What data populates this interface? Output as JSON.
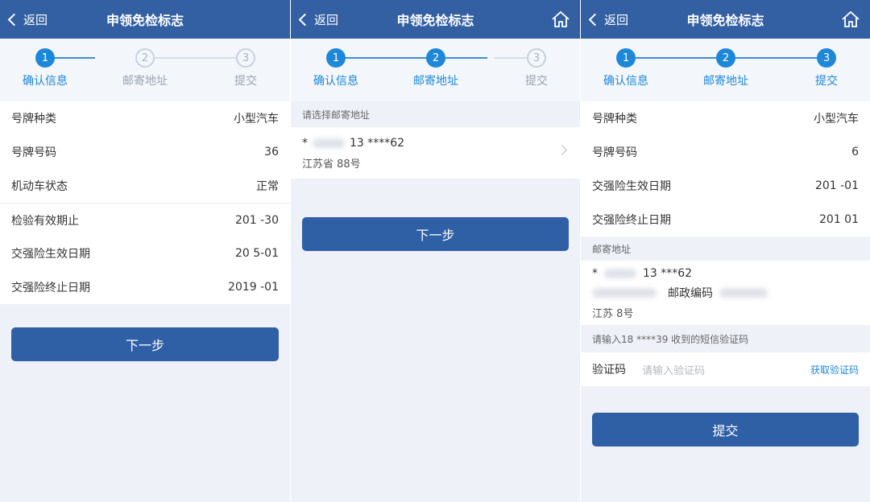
{
  "screens": [
    {
      "nav": {
        "back": "返回",
        "title": "申领免检标志"
      },
      "steps": [
        {
          "num": "1",
          "label": "确认信息",
          "state": "on"
        },
        {
          "num": "2",
          "label": "邮寄地址",
          "state": "off"
        },
        {
          "num": "3",
          "label": "提交",
          "state": "off"
        }
      ],
      "rows": [
        {
          "label": "号牌种类",
          "value": "小型汽车"
        },
        {
          "label": "号牌号码",
          "value": "36"
        },
        {
          "label": "机动车状态",
          "value": "正常"
        },
        {
          "label": "检验有效期止",
          "value": "201 -30"
        },
        {
          "label": "交强险生效日期",
          "value": "20 5-01"
        },
        {
          "label": "交强险终止日期",
          "value": "2019 -01"
        }
      ],
      "button": "下一步"
    },
    {
      "nav": {
        "back": "返回",
        "title": "申领免检标志"
      },
      "steps": [
        {
          "num": "1",
          "label": "确认信息",
          "state": "on"
        },
        {
          "num": "2",
          "label": "邮寄地址",
          "state": "on"
        },
        {
          "num": "3",
          "label": "提交",
          "state": "off"
        }
      ],
      "section_header": "请选择邮寄地址",
      "address": {
        "line1_prefix": "*",
        "phone": "13 ****62",
        "line2": "江苏省 88号"
      },
      "button": "下一步"
    },
    {
      "nav": {
        "back": "返回",
        "title": "申领免检标志"
      },
      "steps": [
        {
          "num": "1",
          "label": "确认信息",
          "state": "on"
        },
        {
          "num": "2",
          "label": "邮寄地址",
          "state": "on"
        },
        {
          "num": "3",
          "label": "提交",
          "state": "on"
        }
      ],
      "rows": [
        {
          "label": "号牌种类",
          "value": "小型汽车"
        },
        {
          "label": "号牌号码",
          "value": "6"
        },
        {
          "label": "交强险生效日期",
          "value": "201 -01"
        },
        {
          "label": "交强险终止日期",
          "value": "201 01"
        }
      ],
      "mail_header": "邮寄地址",
      "address": {
        "line1_prefix": "*",
        "phone": "13 ***62",
        "postcode_label": "邮政编码",
        "line3": "江苏 8号"
      },
      "sms_hint": "请输入18 ****39 收到的短信验证码",
      "code": {
        "label": "验证码",
        "placeholder": "请输入验证码",
        "get": "获取验证码"
      },
      "button": "提交"
    }
  ]
}
